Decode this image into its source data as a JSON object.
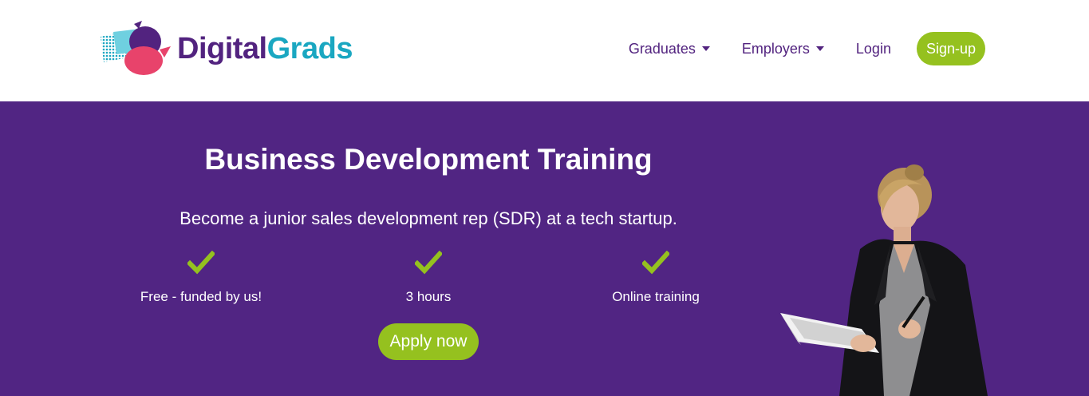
{
  "brand": {
    "name_part1": "Digital",
    "name_part2": "Grads"
  },
  "nav": {
    "graduates": "Graduates",
    "employers": "Employers",
    "login": "Login",
    "signup": "Sign-up"
  },
  "hero": {
    "title": "Business Development Training",
    "subtitle": "Become a junior sales development rep (SDR) at a tech startup.",
    "features": [
      {
        "label": "Free - funded by us!"
      },
      {
        "label": "3 hours"
      },
      {
        "label": "Online training"
      }
    ],
    "cta": "Apply now"
  },
  "colors": {
    "brand_purple": "#52237f",
    "hero_background": "#512583",
    "accent_green": "#95c11f",
    "brand_teal": "#1aa7c1",
    "logo_pink": "#e8436b"
  },
  "icons": [
    "logo-icon",
    "chevron-down-icon",
    "checkmark-icon"
  ]
}
